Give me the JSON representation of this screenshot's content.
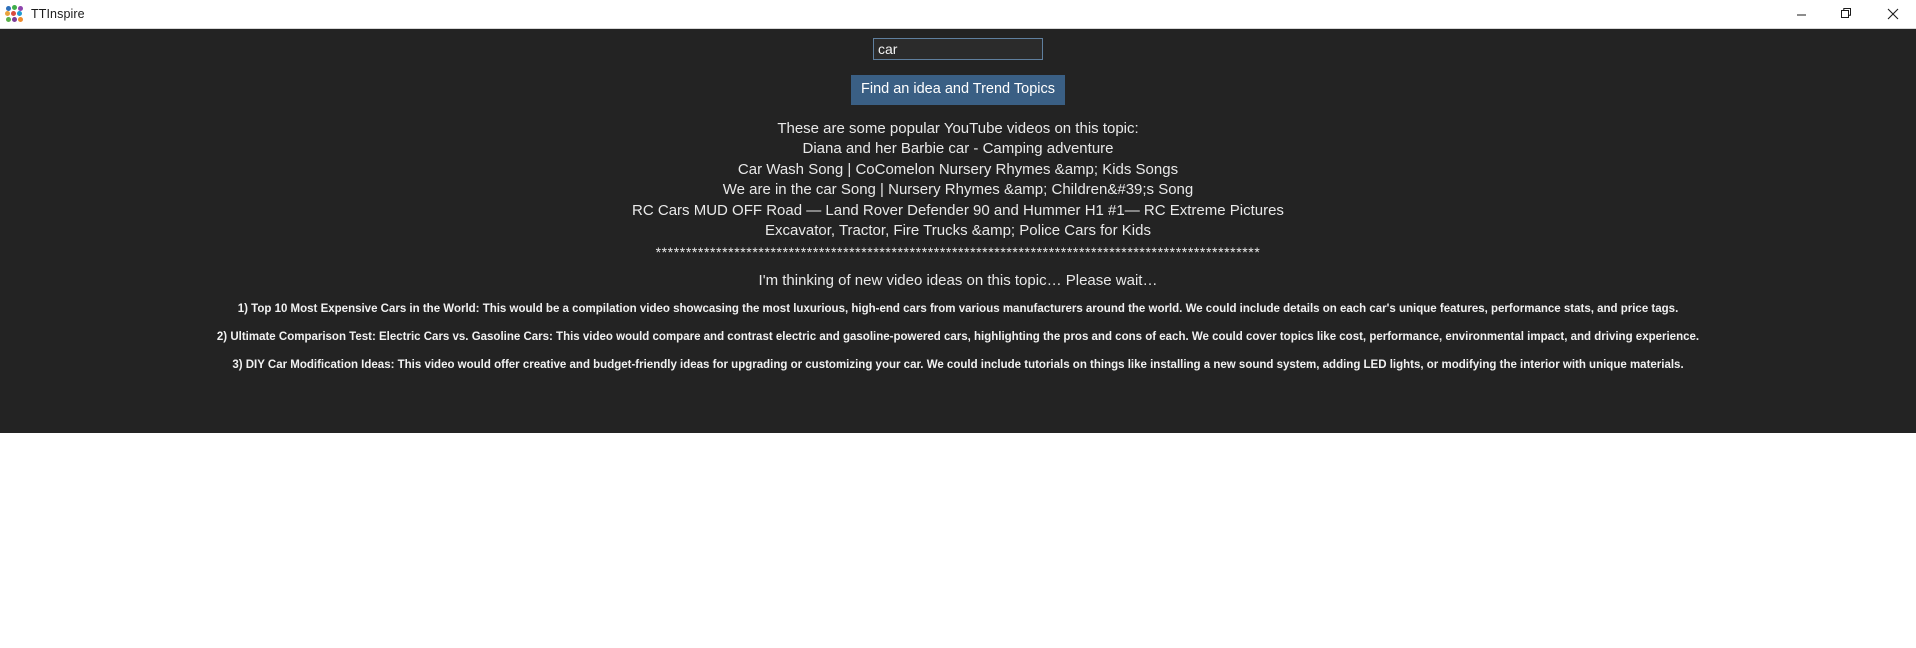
{
  "window": {
    "title": "TTInspire",
    "icon_name": "ttinspire-app-icon",
    "icon_dots": [
      "#2d6fba",
      "#3fae49",
      "#8e44ad",
      "#e8a33d",
      "#d94c3d",
      "#1f9bd1",
      "#59b14a",
      "#7d3c98",
      "#ef8b2c",
      "#cf3c3c",
      "#2b7fc2",
      "#46b04e"
    ],
    "controls": {
      "minimize_label": "Minimize",
      "maximize_label": "Restore",
      "close_label": "Close"
    }
  },
  "search": {
    "value": "car",
    "placeholder": "",
    "button_label": "Find an idea and Trend Topics"
  },
  "results": {
    "heading": "These are some popular YouTube videos on this topic:",
    "videos": [
      "Diana and her Barbie car - Camping adventure",
      "Car Wash Song | CoComelon Nursery Rhymes &amp; Kids Songs",
      "We are in the car Song | Nursery Rhymes &amp; Children&#39;s Song",
      "RC Cars MUD OFF Road — Land Rover Defender 90 and Hummer H1 #1— RC Extreme Pictures",
      "Excavator, Tractor, Fire Trucks &amp; Police Cars for Kids"
    ],
    "divider": "****************************************************************************************************",
    "status": "I'm thinking of new video ideas on this topic… Please wait…"
  },
  "ideas": [
    "1) Top 10 Most Expensive Cars in the World: This would be a compilation video showcasing the most luxurious, high-end cars from various manufacturers around the world. We could include details on each car's unique features, performance stats, and price tags.",
    "2) Ultimate Comparison Test: Electric Cars vs. Gasoline Cars: This video would compare and contrast electric and gasoline-powered cars, highlighting the pros and cons of each. We could cover topics like cost, performance, environmental impact, and driving experience.",
    "3) DIY Car Modification Ideas: This video would offer creative and budget-friendly ideas for upgrading or customizing your car. We could include tutorials on things like installing a new sound system, adding LED lights, or modifying the interior with unique materials."
  ],
  "colors": {
    "app_background": "#232323",
    "titlebar_background": "#ffffff",
    "button_background": "#3a5f84",
    "input_border": "#5f7f9e",
    "text": "#e9e9e9"
  }
}
